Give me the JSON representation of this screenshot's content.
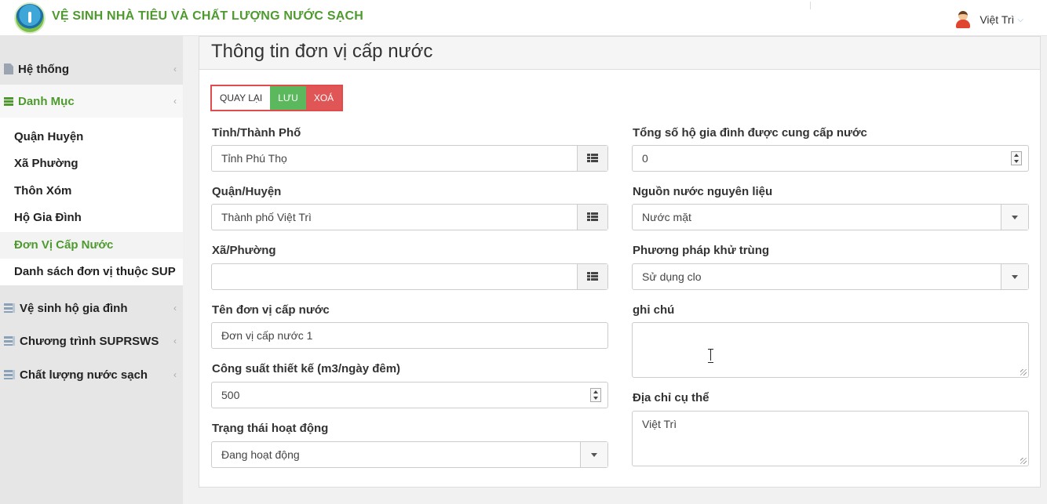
{
  "header": {
    "app_title": "VỆ SINH NHÀ TIÊU VÀ CHẤT LƯỢNG NƯỚC SẠCH",
    "user_name": "Việt Trì"
  },
  "sidebar": {
    "sections": [
      {
        "label": "Hệ thống",
        "icon": "file-icon"
      },
      {
        "label": "Danh Mục",
        "icon": "list-icon"
      },
      {
        "label": "Vệ sinh hộ gia đình",
        "icon": "database-icon"
      },
      {
        "label": "Chương trình SUPRSWS",
        "icon": "database-icon"
      },
      {
        "label": "Chất lượng nước sạch",
        "icon": "database-icon"
      }
    ],
    "sub_items": [
      {
        "label": "Quận Huyện"
      },
      {
        "label": "Xã Phường"
      },
      {
        "label": "Thôn Xóm"
      },
      {
        "label": "Hộ Gia Đình"
      },
      {
        "label": "Đơn Vị Cấp Nước",
        "active": true
      },
      {
        "label": "Danh sách đơn vị thuộc SUP"
      }
    ]
  },
  "panel": {
    "title": "Thông tin đơn vị cấp nước",
    "buttons": {
      "back": "QUAY LẠI",
      "save": "LƯU",
      "delete": "XOÁ"
    },
    "accent_colors": {
      "save": "#5cb85c",
      "delete": "#e05555",
      "brand": "#4e9a2e"
    }
  },
  "form": {
    "province": {
      "label": "Tỉnh/Thành Phố",
      "value": "Tỉnh Phú Thọ"
    },
    "district": {
      "label": "Quận/Huyện",
      "value": "Thành phố Việt Trì"
    },
    "ward": {
      "label": "Xã/Phường",
      "value": ""
    },
    "unit_name": {
      "label": "Tên đơn vị cấp nước",
      "value": "Đơn vị cấp nước 1"
    },
    "capacity": {
      "label": "Công suất thiết kế (m3/ngày đêm)",
      "value": "500"
    },
    "status": {
      "label": "Trạng thái hoạt động",
      "value": "Đang hoạt động"
    },
    "households": {
      "label": "Tổng số hộ gia đình được cung cấp nước",
      "value": "0"
    },
    "water_source": {
      "label": "Nguồn nước nguyên liệu",
      "value": "Nước mặt"
    },
    "disinfection": {
      "label": "Phương pháp khử trùng",
      "value": "Sử dụng clo"
    },
    "note": {
      "label": "ghi chú",
      "value": ""
    },
    "address": {
      "label": "Địa chỉ cụ thể",
      "value": "Việt Trì"
    }
  }
}
